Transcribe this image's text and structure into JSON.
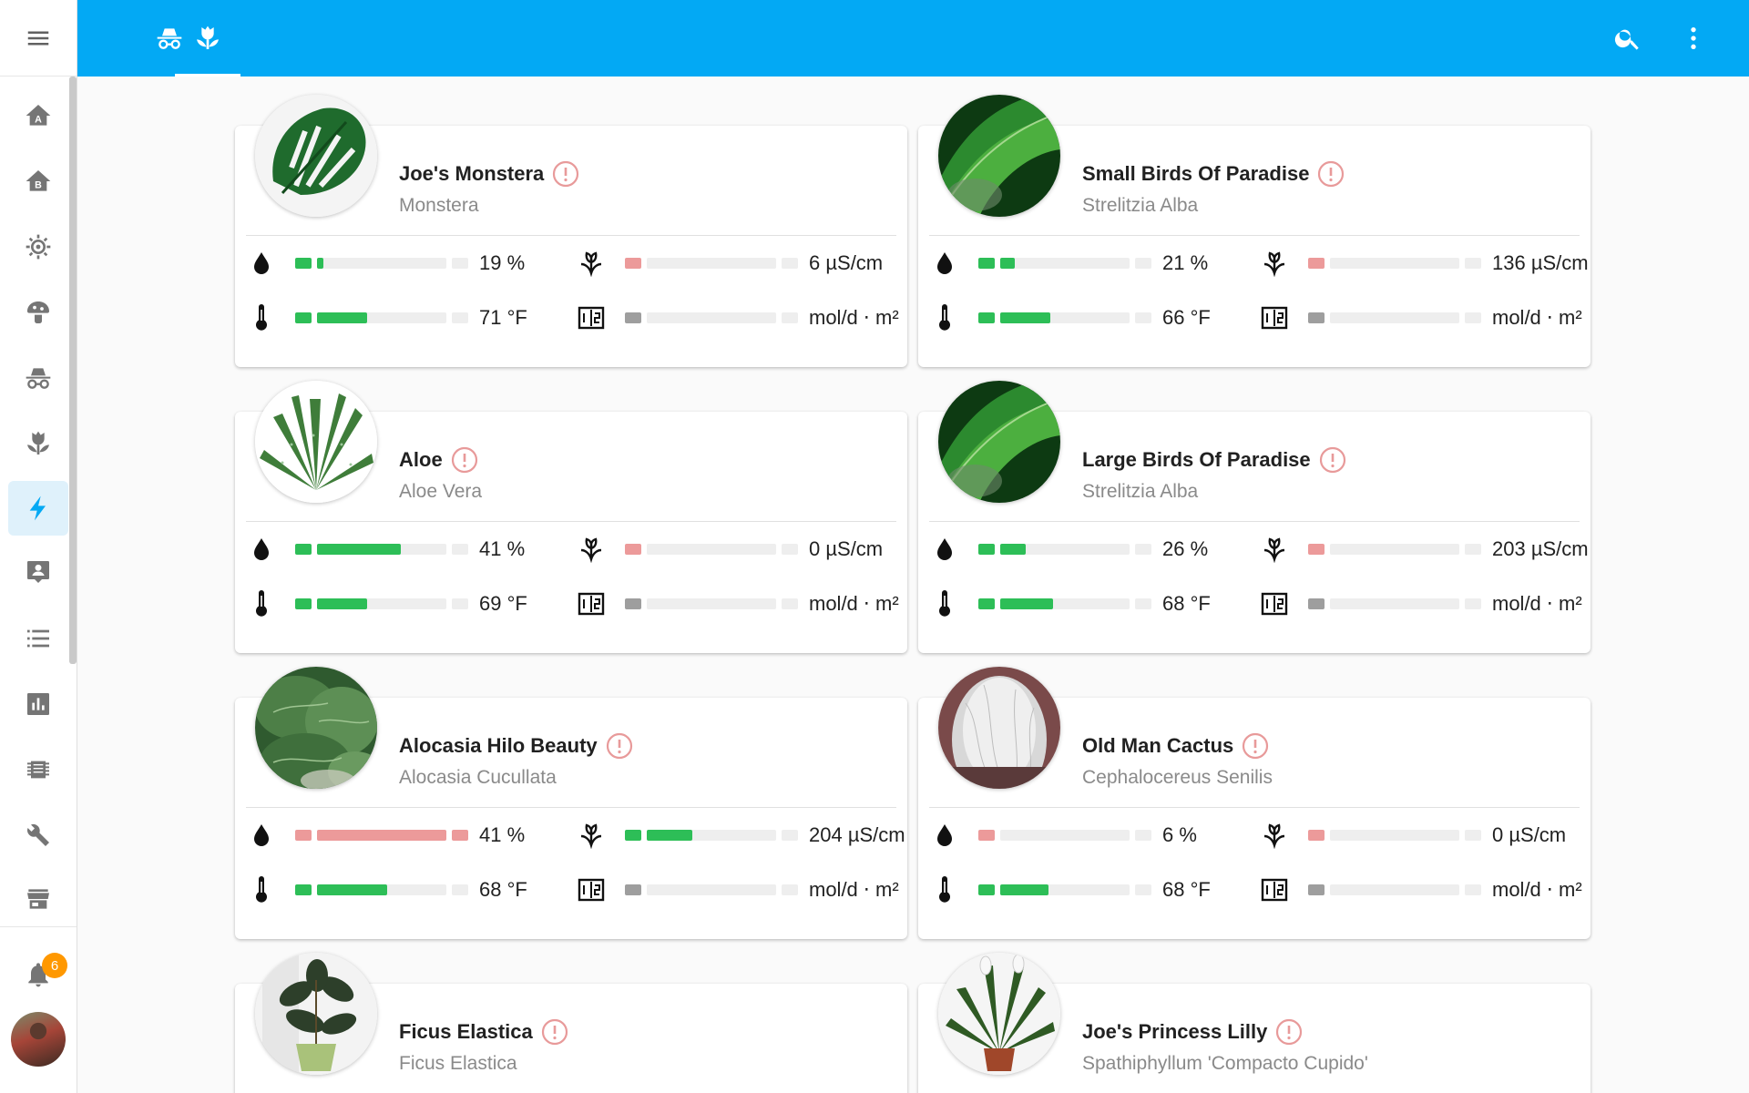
{
  "sidebar": {
    "menu_icon": "menu-icon",
    "items": [
      {
        "icon": "home-a-icon"
      },
      {
        "icon": "home-b-icon"
      },
      {
        "icon": "robot-vacuum-icon"
      },
      {
        "icon": "mushroom-icon"
      },
      {
        "icon": "incognito-icon"
      },
      {
        "icon": "flower-tulip-icon"
      },
      {
        "icon": "lightning-icon",
        "active": true
      },
      {
        "icon": "account-box-icon"
      },
      {
        "icon": "list-icon"
      },
      {
        "icon": "chart-icon"
      },
      {
        "icon": "chip-icon"
      },
      {
        "icon": "wrench-icon"
      },
      {
        "icon": "store-icon"
      }
    ],
    "notifications_badge": "6"
  },
  "header": {
    "tabs": [
      {
        "icon": "incognito-icon",
        "active": false
      },
      {
        "icon": "flower-tulip-icon",
        "active": true
      }
    ],
    "actions": [
      {
        "icon": "search-icon"
      },
      {
        "icon": "more-vertical-icon"
      }
    ]
  },
  "colors": {
    "header": "#03a9f4",
    "good": "#2dbe57",
    "bad": "#ec9a9a",
    "neutral": "#9e9e9e",
    "track": "#eeeeee"
  },
  "plants": [
    {
      "name": "Joe's Monstera",
      "species": "Monstera",
      "image": "monstera",
      "moisture": {
        "value": "19 %",
        "state": "good",
        "fill": 0.05
      },
      "conductivity": {
        "value": "6 µS/cm",
        "state": "bad",
        "fill": 0
      },
      "temperature": {
        "value": "71 °F",
        "state": "good",
        "fill": 0.39
      },
      "illuminance": {
        "value": "mol/d ⋅ m²",
        "state": "neutral",
        "fill": 0
      }
    },
    {
      "name": "Small Birds Of Paradise",
      "species": "Strelitzia Alba",
      "image": "paradise",
      "moisture": {
        "value": "21 %",
        "state": "good",
        "fill": 0.11
      },
      "conductivity": {
        "value": "136 µS/cm",
        "state": "bad",
        "fill": 0
      },
      "temperature": {
        "value": "66 °F",
        "state": "good",
        "fill": 0.39
      },
      "illuminance": {
        "value": "mol/d ⋅ m²",
        "state": "neutral",
        "fill": 0
      }
    },
    {
      "name": "Aloe",
      "species": "Aloe Vera",
      "image": "aloe",
      "moisture": {
        "value": "41 %",
        "state": "good",
        "fill": 0.65
      },
      "conductivity": {
        "value": "0 µS/cm",
        "state": "bad",
        "fill": 0
      },
      "temperature": {
        "value": "69 °F",
        "state": "good",
        "fill": 0.39
      },
      "illuminance": {
        "value": "mol/d ⋅ m²",
        "state": "neutral",
        "fill": 0
      }
    },
    {
      "name": "Large Birds Of Paradise",
      "species": "Strelitzia Alba",
      "image": "paradise",
      "moisture": {
        "value": "26 %",
        "state": "good",
        "fill": 0.2
      },
      "conductivity": {
        "value": "203 µS/cm",
        "state": "bad",
        "fill": 0
      },
      "temperature": {
        "value": "68 °F",
        "state": "good",
        "fill": 0.41
      },
      "illuminance": {
        "value": "mol/d ⋅ m²",
        "state": "neutral",
        "fill": 0
      }
    },
    {
      "name": "Alocasia Hilo Beauty",
      "species": "Alocasia Cucullata",
      "image": "alocasia",
      "moisture": {
        "value": "41 %",
        "state": "bad",
        "fill": 1
      },
      "conductivity": {
        "value": "204 µS/cm",
        "state": "good",
        "fill": 0.35
      },
      "temperature": {
        "value": "68 °F",
        "state": "good",
        "fill": 0.54
      },
      "illuminance": {
        "value": "mol/d ⋅ m²",
        "state": "neutral",
        "fill": 0
      }
    },
    {
      "name": "Old Man Cactus",
      "species": "Cephalocereus Senilis",
      "image": "cactus",
      "moisture": {
        "value": "6 %",
        "state": "bad",
        "fill": 0
      },
      "conductivity": {
        "value": "0 µS/cm",
        "state": "bad",
        "fill": 0
      },
      "temperature": {
        "value": "68 °F",
        "state": "good",
        "fill": 0.37
      },
      "illuminance": {
        "value": "mol/d ⋅ m²",
        "state": "neutral",
        "fill": 0
      }
    },
    {
      "name": "Ficus Elastica",
      "species": "Ficus Elastica",
      "image": "ficus"
    },
    {
      "name": "Joe's Princess Lilly",
      "species": "Spathiphyllum 'Compacto Cupido'",
      "image": "lilly"
    }
  ]
}
